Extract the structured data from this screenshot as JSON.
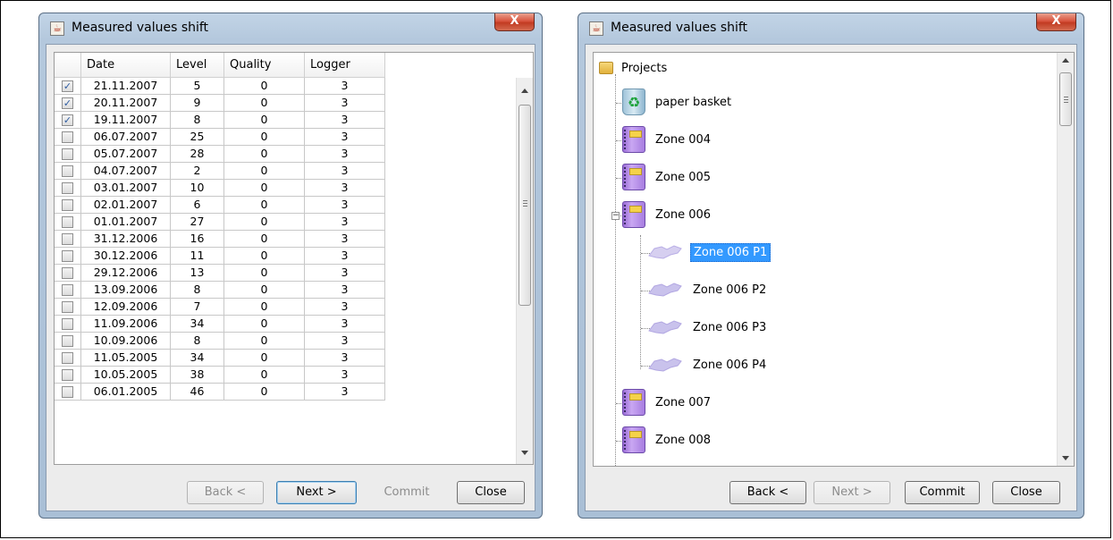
{
  "left_window": {
    "title": "Measured values shift",
    "close_glyph": "X",
    "table": {
      "columns": [
        "",
        "Date",
        "Level",
        "Quality",
        "Logger"
      ],
      "rows": [
        {
          "checked": true,
          "date": "21.11.2007",
          "level": "5",
          "quality": "0",
          "logger": "3"
        },
        {
          "checked": true,
          "date": "20.11.2007",
          "level": "9",
          "quality": "0",
          "logger": "3"
        },
        {
          "checked": true,
          "date": "19.11.2007",
          "level": "8",
          "quality": "0",
          "logger": "3"
        },
        {
          "checked": false,
          "date": "06.07.2007",
          "level": "25",
          "quality": "0",
          "logger": "3"
        },
        {
          "checked": false,
          "date": "05.07.2007",
          "level": "28",
          "quality": "0",
          "logger": "3"
        },
        {
          "checked": false,
          "date": "04.07.2007",
          "level": "2",
          "quality": "0",
          "logger": "3"
        },
        {
          "checked": false,
          "date": "03.01.2007",
          "level": "10",
          "quality": "0",
          "logger": "3"
        },
        {
          "checked": false,
          "date": "02.01.2007",
          "level": "6",
          "quality": "0",
          "logger": "3"
        },
        {
          "checked": false,
          "date": "01.01.2007",
          "level": "27",
          "quality": "0",
          "logger": "3"
        },
        {
          "checked": false,
          "date": "31.12.2006",
          "level": "16",
          "quality": "0",
          "logger": "3"
        },
        {
          "checked": false,
          "date": "30.12.2006",
          "level": "11",
          "quality": "0",
          "logger": "3"
        },
        {
          "checked": false,
          "date": "29.12.2006",
          "level": "13",
          "quality": "0",
          "logger": "3"
        },
        {
          "checked": false,
          "date": "13.09.2006",
          "level": "8",
          "quality": "0",
          "logger": "3"
        },
        {
          "checked": false,
          "date": "12.09.2006",
          "level": "7",
          "quality": "0",
          "logger": "3"
        },
        {
          "checked": false,
          "date": "11.09.2006",
          "level": "34",
          "quality": "0",
          "logger": "3"
        },
        {
          "checked": false,
          "date": "10.09.2006",
          "level": "8",
          "quality": "0",
          "logger": "3"
        },
        {
          "checked": false,
          "date": "11.05.2005",
          "level": "34",
          "quality": "0",
          "logger": "3"
        },
        {
          "checked": false,
          "date": "10.05.2005",
          "level": "38",
          "quality": "0",
          "logger": "3"
        },
        {
          "checked": false,
          "date": "06.01.2005",
          "level": "46",
          "quality": "0",
          "logger": "3"
        }
      ]
    },
    "buttons": {
      "back": "Back <",
      "next": "Next >",
      "commit": "Commit",
      "close": "Close"
    }
  },
  "right_window": {
    "title": "Measured values shift",
    "close_glyph": "X",
    "tree": {
      "root": "Projects",
      "nodes": [
        {
          "label": "paper basket",
          "icon": "recycle-bin-icon"
        },
        {
          "label": "Zone 004",
          "icon": "notebook-icon"
        },
        {
          "label": "Zone 005",
          "icon": "notebook-icon"
        },
        {
          "label": "Zone 006",
          "icon": "notebook-icon",
          "expanded": true
        },
        {
          "label": "Zone 006 P1",
          "icon": "map-icon",
          "selected": true
        },
        {
          "label": "Zone 006 P2",
          "icon": "map-icon"
        },
        {
          "label": "Zone 006 P3",
          "icon": "map-icon"
        },
        {
          "label": "Zone 006 P4",
          "icon": "map-icon"
        },
        {
          "label": "Zone 007",
          "icon": "notebook-icon"
        },
        {
          "label": "Zone 008",
          "icon": "notebook-icon"
        }
      ]
    },
    "buttons": {
      "back": "Back <",
      "next": "Next >",
      "commit": "Commit",
      "close": "Close"
    }
  },
  "colors": {
    "selection": "#3399ff",
    "window_frame": "#a9bfd6",
    "close_button": "#c23b22"
  }
}
